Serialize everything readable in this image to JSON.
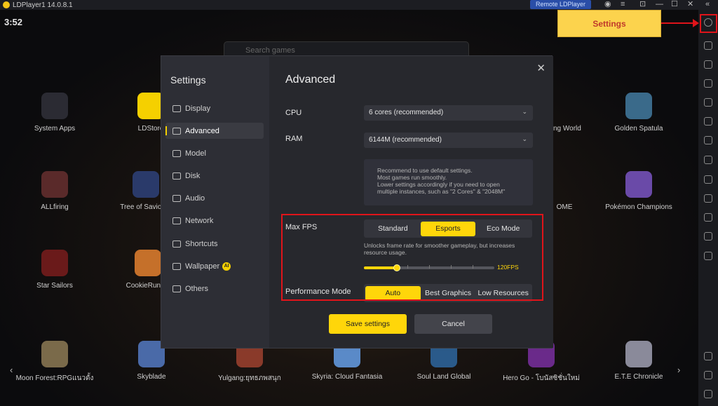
{
  "window": {
    "title": "LDPlayer1 14.0.8.1",
    "remote_label": "Remote LDPlayer",
    "controls": [
      "⊡",
      "—",
      "☐",
      "✕"
    ]
  },
  "status": {
    "time": "3:52"
  },
  "search": {
    "placeholder": "Search games"
  },
  "apps": [
    {
      "label": "System Apps",
      "color": "#2b2b33"
    },
    {
      "label": "LDStore",
      "color": "#f5d000"
    },
    {
      "label": "ning World",
      "color": "#4a3a2a"
    },
    {
      "label": "Golden Spatula",
      "color": "#3a6a8a"
    },
    {
      "label": "ALLfiring",
      "color": "#5a2a2a"
    },
    {
      "label": "Tree of Savior M",
      "color": "#2a3a6a"
    },
    {
      "label": "OME",
      "color": "#2a4a3a"
    },
    {
      "label": "Pokémon Champions",
      "color": "#6a4aa8"
    },
    {
      "label": "Star Sailors",
      "color": "#6a1a1a"
    },
    {
      "label": "CookieRun: O",
      "color": "#c5702a"
    },
    {
      "label": "Moon Forest:RPGแนวดั้ง",
      "color": "#7a6a4a"
    },
    {
      "label": "Skyblade",
      "color": "#4a6aa8"
    },
    {
      "label": "Yulgang:ยุทธภพสนุก",
      "color": "#8a3a2a"
    },
    {
      "label": "Skyria: Cloud Fantasia",
      "color": "#5a8ac8"
    },
    {
      "label": "Soul Land Global",
      "color": "#2a5a8a"
    },
    {
      "label": "Hero Go - โบนัสซิชั่นใหม่",
      "color": "#6a2a8a"
    },
    {
      "label": "E.T.E Chronicle",
      "color": "#8a8a9a"
    }
  ],
  "callout": {
    "label": "Settings"
  },
  "dialog": {
    "title": "Settings",
    "nav": [
      {
        "label": "Display",
        "icon": "display-icon"
      },
      {
        "label": "Advanced",
        "icon": "advanced-icon",
        "active": true
      },
      {
        "label": "Model",
        "icon": "model-icon"
      },
      {
        "label": "Disk",
        "icon": "disk-icon"
      },
      {
        "label": "Audio",
        "icon": "audio-icon"
      },
      {
        "label": "Network",
        "icon": "network-icon"
      },
      {
        "label": "Shortcuts",
        "icon": "shortcuts-icon"
      },
      {
        "label": "Wallpaper",
        "icon": "wallpaper-icon",
        "badge": "AI"
      },
      {
        "label": "Others",
        "icon": "others-icon"
      }
    ],
    "section_title": "Advanced",
    "cpu": {
      "label": "CPU",
      "value": "6 cores (recommended)"
    },
    "ram": {
      "label": "RAM",
      "value": "6144M (recommended)"
    },
    "note": "Recommend to use default settings.\nMost games run smoothly.\nLower settings accordingly if you need to open\nmultiple instances, such as \"2 Cores\" & \"2048M\"",
    "fps": {
      "label": "Max FPS",
      "options": [
        "Standard",
        "Esports",
        "Eco Mode"
      ],
      "selected": "Esports",
      "note": "Unlocks frame rate for smoother gameplay, but increases resource usage.",
      "value_label": "120FPS",
      "level": 0.25
    },
    "perf": {
      "label": "Performance Mode",
      "options": [
        "Auto",
        "Best Graphics",
        "Low Resources"
      ],
      "selected": "Auto"
    },
    "save_label": "Save settings",
    "cancel_label": "Cancel"
  }
}
